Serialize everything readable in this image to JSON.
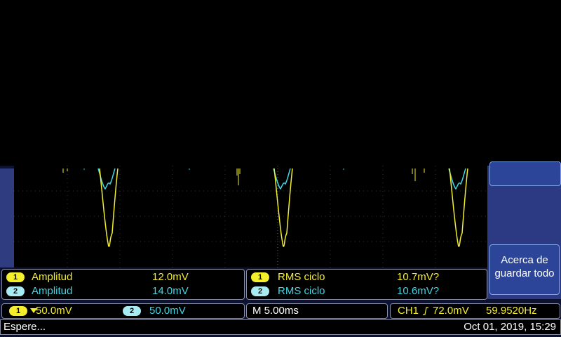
{
  "measurements": {
    "left": [
      {
        "channel": "1",
        "name": "Amplitud",
        "value": "12.0mV"
      },
      {
        "channel": "2",
        "name": "Amplitud",
        "value": "14.0mV"
      }
    ],
    "right": [
      {
        "channel": "1",
        "name": "RMS ciclo",
        "value": "10.7mV?"
      },
      {
        "channel": "2",
        "name": "RMS ciclo",
        "value": "10.6mV?"
      }
    ]
  },
  "side_menu": {
    "save_about_label": "Acerca de guardar todo"
  },
  "scale": {
    "ch1_badge": "1",
    "ch1_scale": "50.0mV",
    "ch2_badge": "2",
    "ch2_scale": "50.0mV",
    "timebase": "M 5.00ms",
    "trigger_source": "CH1",
    "trigger_slope_icon": "rising-edge-icon",
    "trigger_level": "72.0mV",
    "frequency": "59.9520Hz"
  },
  "status": {
    "message": "Espere...",
    "datetime": "Oct 01, 2019, 15:29"
  },
  "colors": {
    "ch1": "#f4ee2c",
    "ch2": "#40d6e6",
    "frame": "#2b3a82"
  }
}
